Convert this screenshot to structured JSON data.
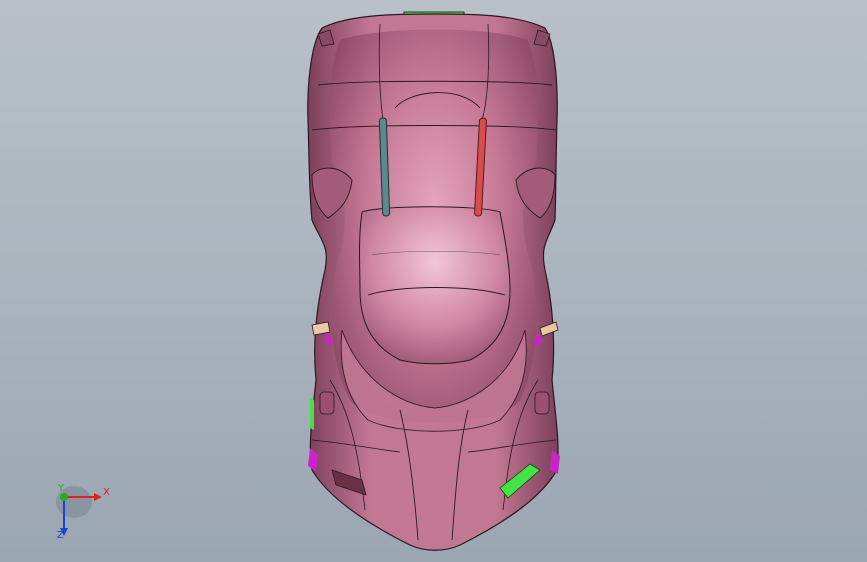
{
  "viewport": {
    "background_top": "#b9c0c8",
    "background_bottom": "#9aa6b2"
  },
  "model": {
    "body_color": "#c0728f",
    "highlight_color": "#e6a9c0",
    "edge_color": "#2a1820",
    "accent_green": "#44e244",
    "accent_magenta": "#cc22cc",
    "left_rod_color": "#5a8a8a",
    "right_rod_color": "#d94c4c"
  },
  "triad": {
    "x_label": "X",
    "y_label": "Y",
    "z_label": "Z",
    "x_color": "#e02020",
    "y_color": "#20b020",
    "z_color": "#2040d0"
  }
}
